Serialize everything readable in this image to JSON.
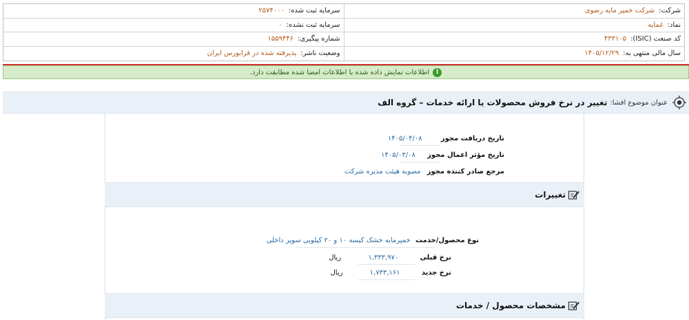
{
  "info": {
    "rows": [
      {
        "right_label": "شرکت:",
        "right_value": "شرکت خمیر مایه رضوی",
        "left_label": "سرمایه ثبت شده:",
        "left_value": "۲۵۷۴۰۰۰"
      },
      {
        "right_label": "نماد:",
        "right_value": "غمایه",
        "left_label": "سرمایه ثبت نشده:",
        "left_value": "۰"
      },
      {
        "right_label": "کد صنعت (ISIC):",
        "right_value": "۴۳۳۱۰۵",
        "left_label": "شماره پیگیری:",
        "left_value": "۱۵۵۹۴۴۶"
      },
      {
        "right_label": "سال مالی منتهی به:",
        "right_value": "۱۴۰۵/۱۲/۲۹",
        "left_label": "وضعیت ناشر:",
        "left_value": "پذیرفته شده در فرابورس ایران"
      }
    ]
  },
  "notice": {
    "text": "اطلاعات نمایش داده شده با اطلاعات امضا شده مطابقت دارد.",
    "icon": "info-icon"
  },
  "subject": {
    "label": "عنوان موضوع افشا:",
    "title": "تغییر در نرخ فروش محصولات یا ارائه خدمات – گروه الف",
    "icon": "target-icon"
  },
  "permit": {
    "received_label": "تاریخ دریافت مجوز",
    "received_value": "۱۴۰۵/۰۴/۰۸",
    "effective_label": "تاریخ مؤثر اعمال مجوز",
    "effective_value": "۱۴۰۵/۰۳/۰۸",
    "issuer_label": "مرجع صادر کننده مجوز",
    "issuer_value": "مصوبه هیئت مدیره شرکت"
  },
  "changes": {
    "title": "تغییرات",
    "icon": "edit-icon",
    "product_label": "نوع محصول/خدمت",
    "product_value": "خمیرمایه خشک کیسه ۱۰ و ۲۰ کیلویی سوپر داخلی",
    "old_label": "نرخ قبلی",
    "old_value": "۱,۳۳۳,۹۷۰",
    "old_unit": "ریال",
    "new_label": "نرخ جدید",
    "new_value": "۱,۷۳۳,۱۶۱",
    "new_unit": "ریال"
  },
  "specs": {
    "title": "مشخصات محصول / خدمات",
    "icon": "edit-icon"
  }
}
